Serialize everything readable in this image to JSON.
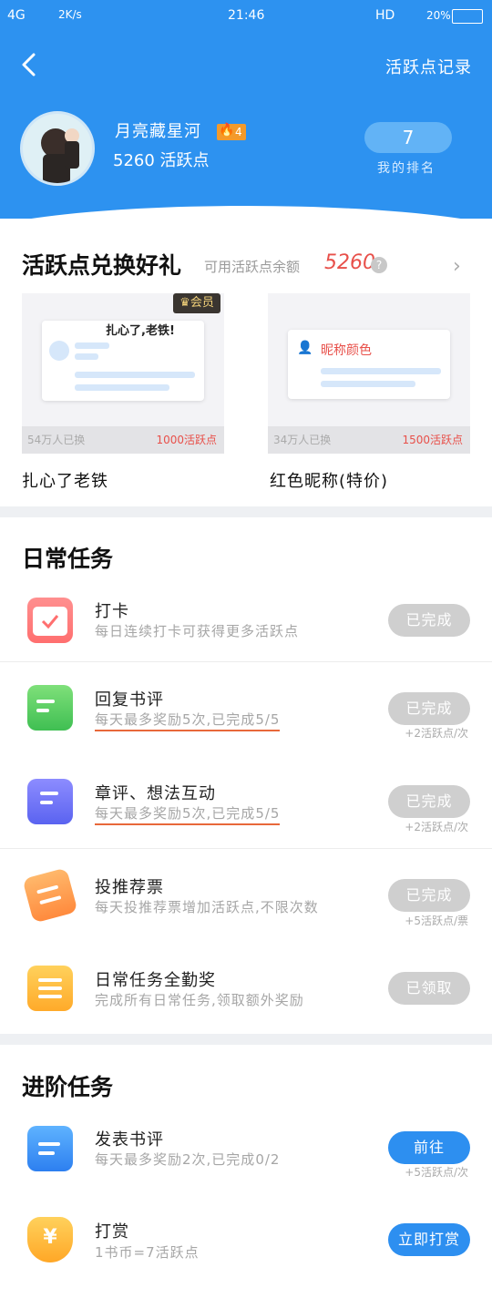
{
  "status_bar": {
    "network": "4G",
    "speed": "2K/s",
    "time": "21:46",
    "hd": "HD",
    "battery": "20%"
  },
  "header": {
    "title_link": "活跃点记录",
    "user_name": "月亮藏星河",
    "level": "4",
    "points_text": "5260 活跃点",
    "rank_value": "7",
    "rank_label": "我的排名"
  },
  "exchange": {
    "title": "活跃点兑换好礼",
    "balance_label": "可用活跃点余额",
    "balance_value": "5260",
    "items": [
      {
        "badge": "会员",
        "preview_text": "扎心了,老铁!",
        "exchanged": "54万人已换",
        "cost": "1000活跃点",
        "title": "扎心了老铁"
      },
      {
        "preview_text": "昵称颜色",
        "exchanged": "34万人已换",
        "cost": "1500活跃点",
        "title": "红色昵称(特价)"
      }
    ]
  },
  "daily": {
    "title": "日常任务",
    "tasks": [
      {
        "title": "打卡",
        "desc": "每日连续打卡可获得更多活跃点",
        "button": "已完成",
        "reward": ""
      },
      {
        "title": "回复书评",
        "desc": "每天最多奖励5次,已完成5/5",
        "button": "已完成",
        "reward": "+2活跃点/次"
      },
      {
        "title": "章评、想法互动",
        "desc": "每天最多奖励5次,已完成5/5",
        "button": "已完成",
        "reward": "+2活跃点/次"
      },
      {
        "title": "投推荐票",
        "desc": "每天投推荐票增加活跃点,不限次数",
        "button": "已完成",
        "reward": "+5活跃点/票"
      },
      {
        "title": "日常任务全勤奖",
        "desc": "完成所有日常任务,领取额外奖励",
        "button": "已领取",
        "reward": ""
      }
    ]
  },
  "advanced": {
    "title": "进阶任务",
    "tasks": [
      {
        "title": "发表书评",
        "desc": "每天最多奖励2次,已完成0/2",
        "button": "前往",
        "reward": "+5活跃点/次"
      },
      {
        "title": "打赏",
        "desc": "1书币=7活跃点",
        "button": "立即打赏",
        "reward": ""
      }
    ]
  },
  "colors": {
    "primary": "#2d92f0",
    "accent_red": "#e8504a",
    "done_gray": "#cfcfcf"
  }
}
